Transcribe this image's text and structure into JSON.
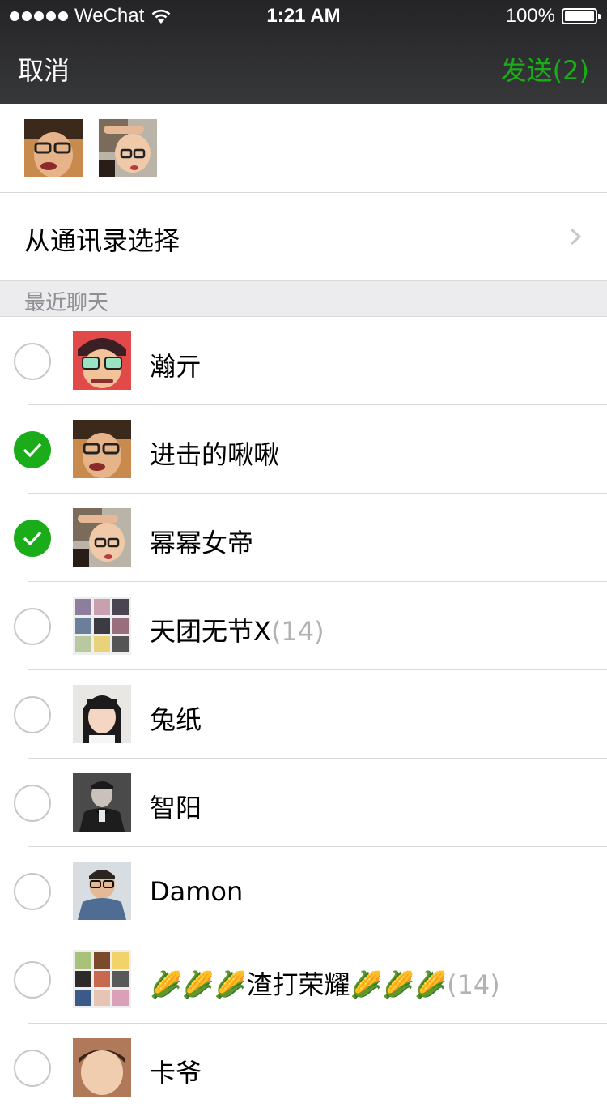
{
  "status_bar": {
    "carrier": "WeChat",
    "time": "1:21 AM",
    "battery": "100%"
  },
  "nav": {
    "cancel": "取消",
    "send": "发送(2)"
  },
  "contacts_entry": {
    "label": "从通讯录选择"
  },
  "section": {
    "title": "最近聊天"
  },
  "chats": [
    {
      "name": "瀚亓",
      "count": "",
      "selected": false,
      "avatar": "cartoon-avatar"
    },
    {
      "name": "进击的啾啾",
      "count": "",
      "selected": true,
      "avatar": "photo-avatar"
    },
    {
      "name": "幂幂女帝",
      "count": "",
      "selected": true,
      "avatar": "photo-avatar"
    },
    {
      "name": "天团无节X",
      "count": "(14)",
      "selected": false,
      "avatar": "group-avatar"
    },
    {
      "name": "兔纸",
      "count": "",
      "selected": false,
      "avatar": "photo-avatar"
    },
    {
      "name": "智阳",
      "count": "",
      "selected": false,
      "avatar": "photo-avatar"
    },
    {
      "name": "Damon",
      "count": "",
      "selected": false,
      "avatar": "photo-avatar"
    },
    {
      "name": "🌽🌽🌽渣打荣耀🌽🌽🌽",
      "count": "(14)",
      "selected": false,
      "avatar": "group-avatar"
    },
    {
      "name": "卡爷",
      "count": "",
      "selected": false,
      "avatar": "photo-avatar"
    }
  ],
  "colors": {
    "accent_green": "#1aad19",
    "nav_background": "#2c2c2e",
    "section_background": "#ececee",
    "muted_text": "#b2b2b2"
  }
}
